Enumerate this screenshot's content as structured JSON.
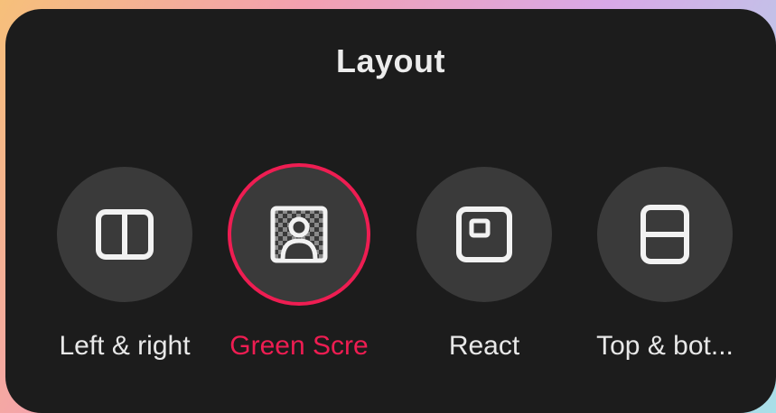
{
  "panel": {
    "title": "Layout"
  },
  "options": [
    {
      "label": "Left & right",
      "icon": "split-vertical-icon",
      "selected": false
    },
    {
      "label": "Green Scre",
      "icon": "green-screen-icon",
      "selected": true
    },
    {
      "label": "React",
      "icon": "react-icon",
      "selected": false
    },
    {
      "label": "Top & bot...",
      "icon": "split-horizontal-icon",
      "selected": false
    }
  ],
  "colors": {
    "panel_bg": "#1c1c1c",
    "circle_bg": "#3a3a3a",
    "accent": "#ee1d52",
    "text": "#e8e8e8"
  }
}
